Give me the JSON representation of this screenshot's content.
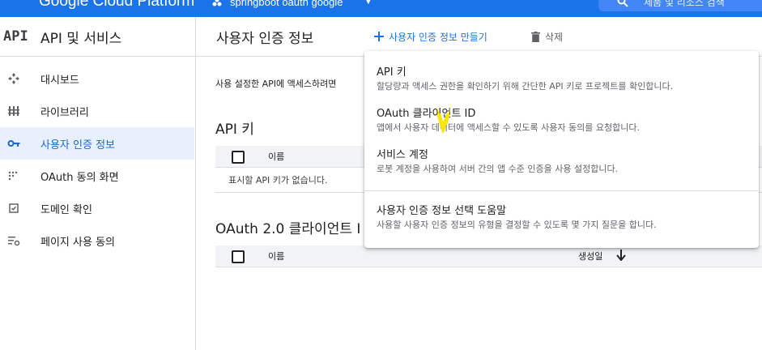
{
  "topbar": {
    "brand": "Google Cloud Platform",
    "project": "springboot oauth google",
    "search_placeholder": "제품 및 리소스 검색"
  },
  "sidebar": {
    "logo": "API",
    "title": "API 및 서비스",
    "items": [
      {
        "label": "대시보드",
        "icon": "dashboard-icon",
        "active": false
      },
      {
        "label": "라이브러리",
        "icon": "library-icon",
        "active": false
      },
      {
        "label": "사용자 인증 정보",
        "icon": "key-icon",
        "active": true
      },
      {
        "label": "OAuth 동의 화면",
        "icon": "consent-screen-icon",
        "active": false
      },
      {
        "label": "도메인 확인",
        "icon": "domain-check-icon",
        "active": false
      },
      {
        "label": "페이지 사용 동의",
        "icon": "page-usage-icon",
        "active": false
      }
    ]
  },
  "main": {
    "title": "사용자 인증 정보",
    "create_label": "사용자 인증 정보 만들기",
    "delete_label": "삭제",
    "description": "사용 설정한 API에 액세스하려면",
    "api_keys": {
      "title": "API 키",
      "col_name": "이름",
      "empty_text": "표시할 API 키가 없습니다."
    },
    "oauth_clients": {
      "title": "OAuth 2.0 클라이언트 I",
      "col_name": "이름",
      "col_created": "생성일"
    }
  },
  "menu": {
    "items": [
      {
        "title": "API 키",
        "desc": "할당량과 액세스 권한을 확인하기 위해 간단한 API 키로 프로젝트를 확인합니다."
      },
      {
        "title": "OAuth 클라이언트 ID",
        "desc": "앱에서 사용자 데이터에 액세스할 수 있도록 사용자 동의를 요청합니다."
      },
      {
        "title": "서비스 계정",
        "desc": "로봇 계정을 사용하여 서버 간의 앱 수준 인증을 사용 설정합니다."
      },
      {
        "title": "사용자 인증 정보 선택 도움말",
        "desc": "사용할 사용자 인증 정보의 유형을 결정할 수 있도록 몇 가지 질문을 합니다."
      }
    ]
  },
  "colors": {
    "brand_blue": "#1a73e8",
    "active_bg": "#e8f0fe",
    "highlight_scribble": "#f5e600"
  }
}
